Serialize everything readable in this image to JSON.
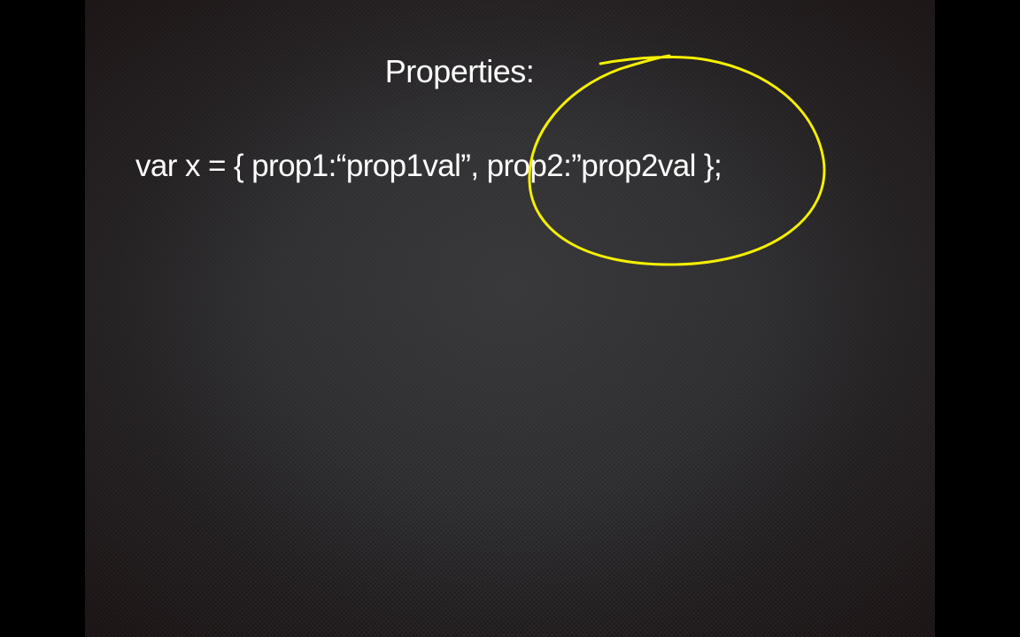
{
  "slide": {
    "title": "Properties:",
    "code": "var x = { prop1:“prop1val”, prop2:”prop2val };"
  },
  "annotation": {
    "shape": "circle",
    "color": "#f4f000"
  }
}
